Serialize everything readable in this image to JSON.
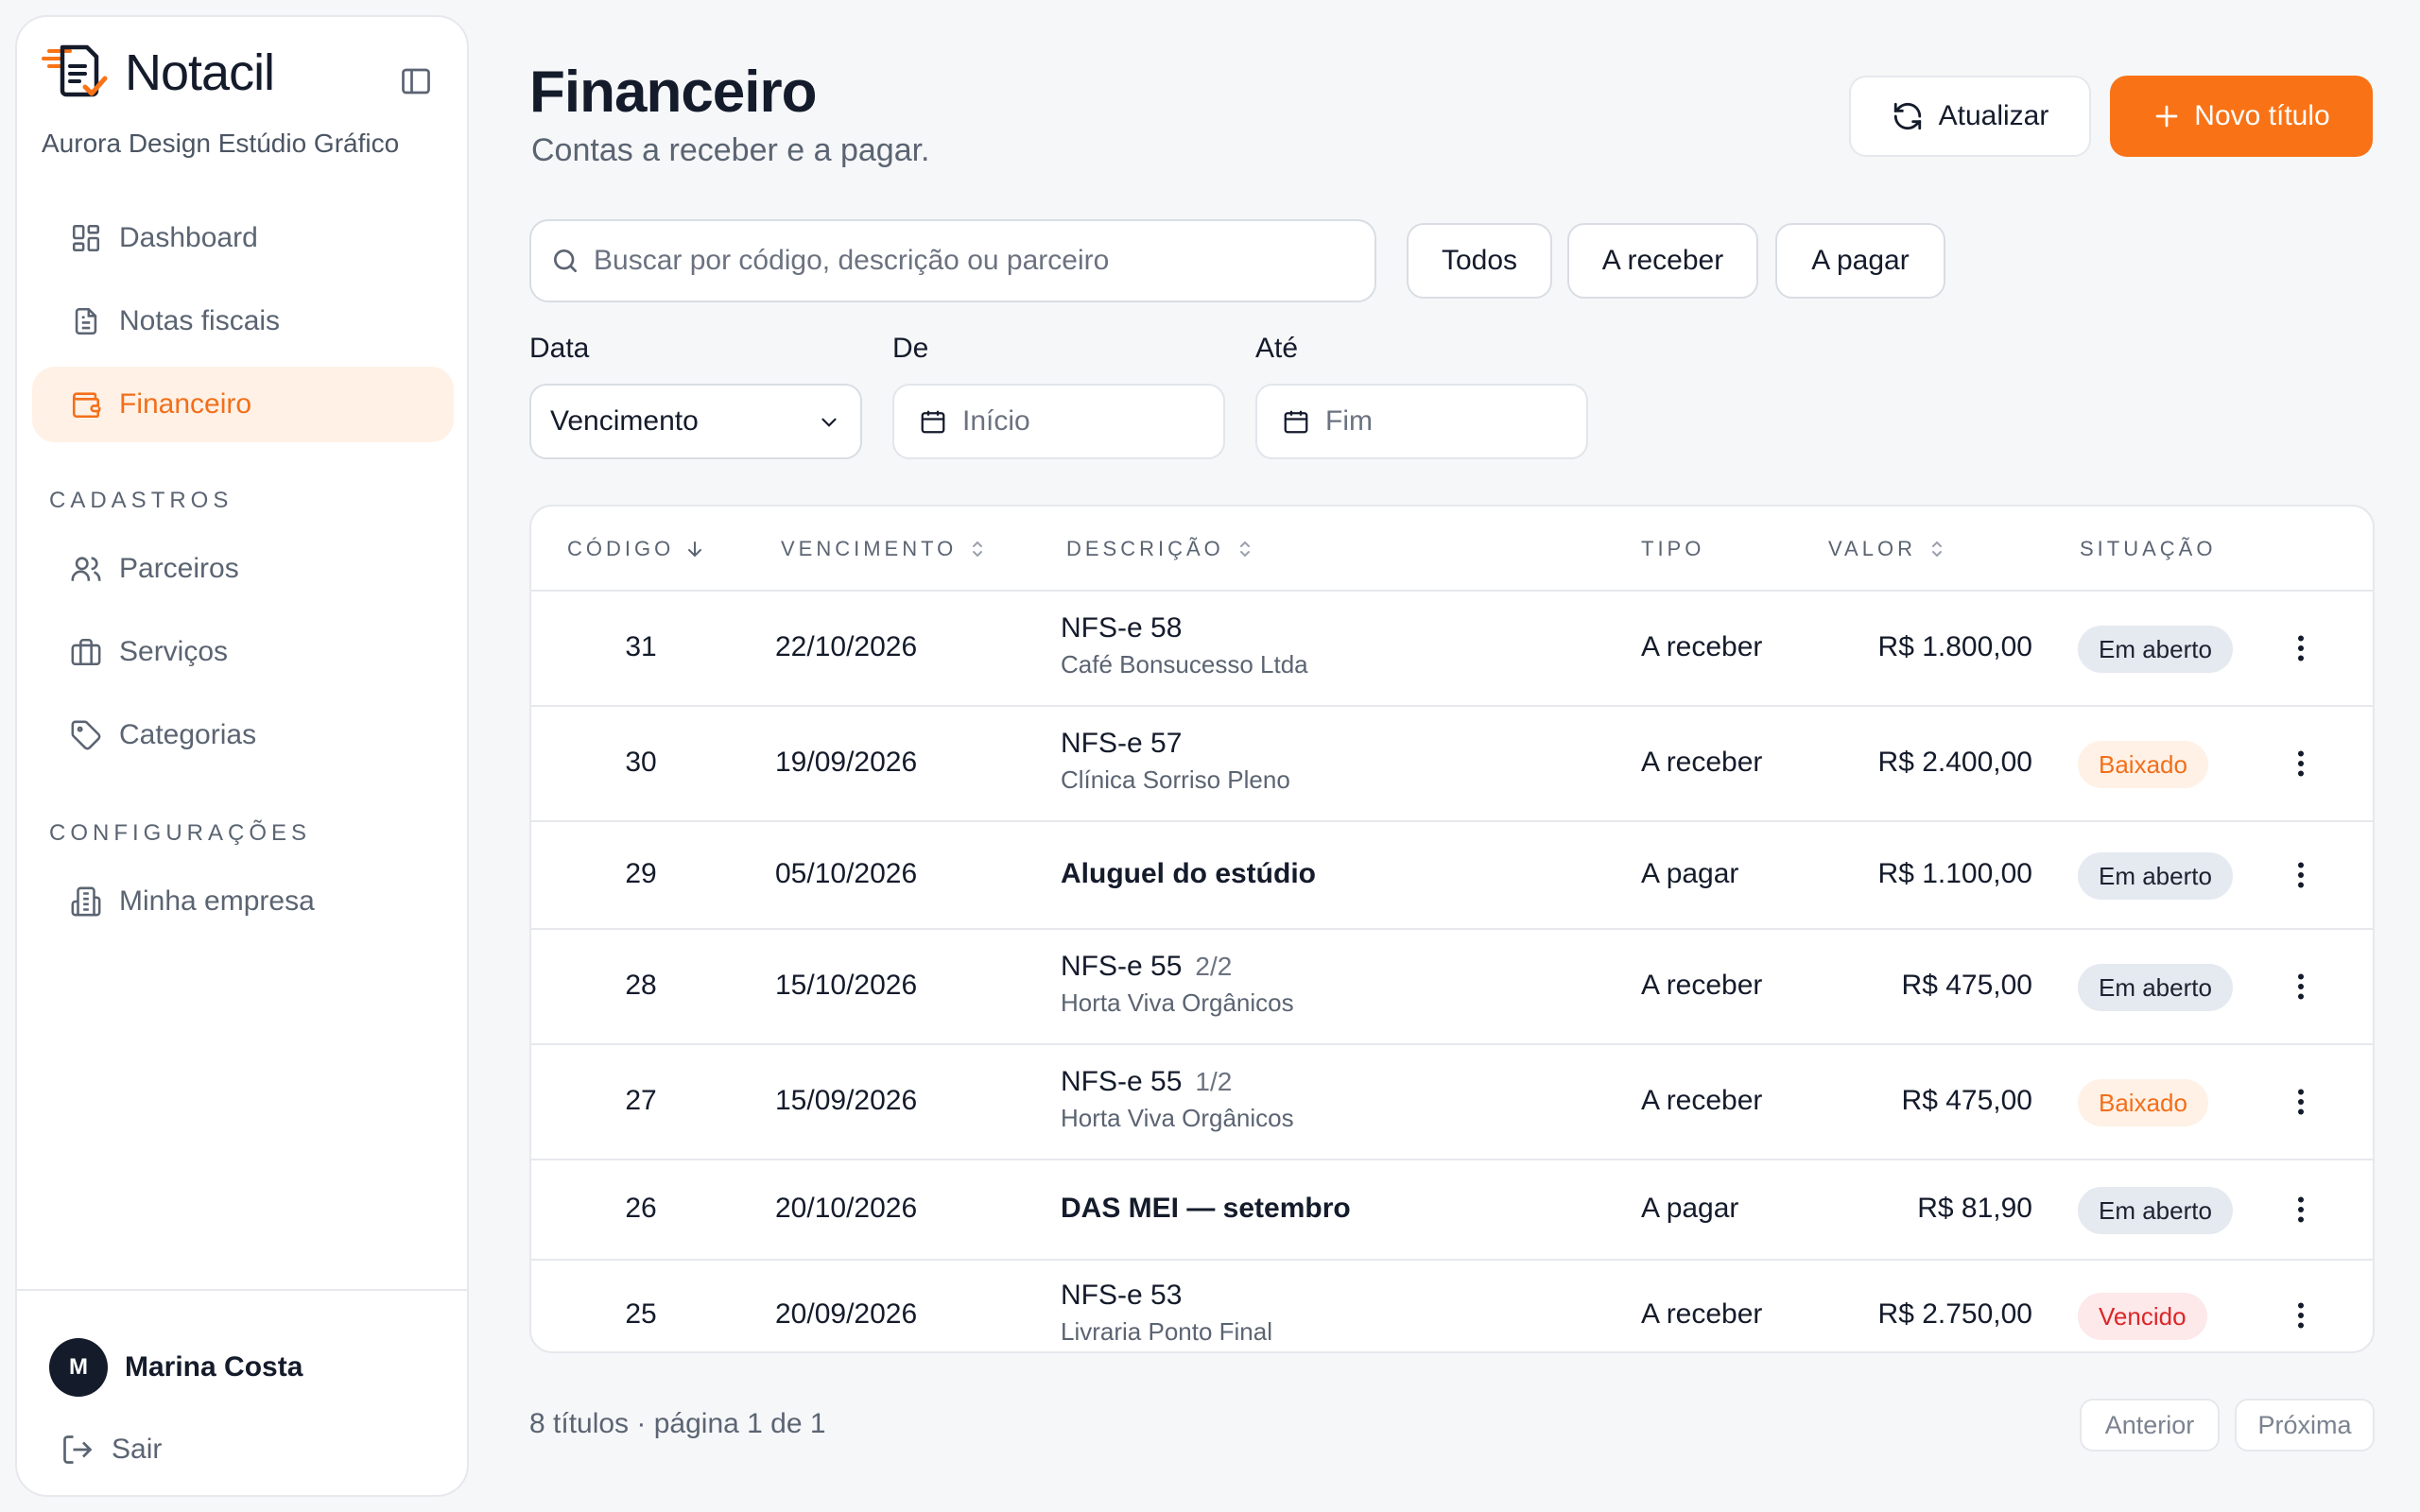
{
  "brand": {
    "name": "Notacil",
    "company": "Aurora Design Estúdio Gráfico"
  },
  "sidebar": {
    "main_items": [
      {
        "label": "Dashboard",
        "icon": "dashboard-icon",
        "active": false
      },
      {
        "label": "Notas fiscais",
        "icon": "document-icon",
        "active": false
      },
      {
        "label": "Financeiro",
        "icon": "wallet-icon",
        "active": true
      }
    ],
    "cadastros_label": "CADASTROS",
    "cadastros_items": [
      {
        "label": "Parceiros",
        "icon": "users-icon"
      },
      {
        "label": "Serviços",
        "icon": "briefcase-icon"
      },
      {
        "label": "Categorias",
        "icon": "tag-icon"
      }
    ],
    "config_label": "CONFIGURAÇÕES",
    "config_items": [
      {
        "label": "Minha empresa",
        "icon": "building-icon"
      }
    ],
    "user": {
      "initial": "M",
      "name": "Marina Costa"
    },
    "logout_label": "Sair"
  },
  "header": {
    "title": "Financeiro",
    "subtitle": "Contas a receber e a pagar.",
    "refresh_label": "Atualizar",
    "new_label": "Novo título"
  },
  "filters": {
    "search_placeholder": "Buscar por código, descrição ou parceiro",
    "tabs": [
      "Todos",
      "A receber",
      "A pagar"
    ],
    "date_label": "Data",
    "date_value": "Vencimento",
    "from_label": "De",
    "from_placeholder": "Início",
    "to_label": "Até",
    "to_placeholder": "Fim"
  },
  "table": {
    "columns": {
      "code": "CÓDIGO",
      "due": "VENCIMENTO",
      "description": "DESCRIÇÃO",
      "type": "TIPO",
      "value": "VALOR",
      "status": "SITUAÇÃO"
    },
    "rows": [
      {
        "code": "31",
        "due": "22/10/2026",
        "desc": "NFS-e 58",
        "installment": "",
        "partner": "Café Bonsucesso Ltda",
        "type": "A receber",
        "value": "R$ 1.800,00",
        "status": "Em aberto",
        "status_kind": "open"
      },
      {
        "code": "30",
        "due": "19/09/2026",
        "desc": "NFS-e 57",
        "installment": "",
        "partner": "Clínica Sorriso Pleno",
        "type": "A receber",
        "value": "R$ 2.400,00",
        "status": "Baixado",
        "status_kind": "paid"
      },
      {
        "code": "29",
        "due": "05/10/2026",
        "desc": "Aluguel do estúdio",
        "installment": "",
        "partner": "",
        "type": "A pagar",
        "value": "R$ 1.100,00",
        "status": "Em aberto",
        "status_kind": "open"
      },
      {
        "code": "28",
        "due": "15/10/2026",
        "desc": "NFS-e 55",
        "installment": "2/2",
        "partner": "Horta Viva Orgânicos",
        "type": "A receber",
        "value": "R$ 475,00",
        "status": "Em aberto",
        "status_kind": "open"
      },
      {
        "code": "27",
        "due": "15/09/2026",
        "desc": "NFS-e 55",
        "installment": "1/2",
        "partner": "Horta Viva Orgânicos",
        "type": "A receber",
        "value": "R$ 475,00",
        "status": "Baixado",
        "status_kind": "paid"
      },
      {
        "code": "26",
        "due": "20/10/2026",
        "desc": "DAS MEI — setembro",
        "installment": "",
        "partner": "",
        "type": "A pagar",
        "value": "R$ 81,90",
        "status": "Em aberto",
        "status_kind": "open"
      },
      {
        "code": "25",
        "due": "20/09/2026",
        "desc": "NFS-e 53",
        "installment": "",
        "partner": "Livraria Ponto Final",
        "type": "A receber",
        "value": "R$ 2.750,00",
        "status": "Vencido",
        "status_kind": "late"
      }
    ]
  },
  "pagination": {
    "info": "8 títulos · página 1 de 1",
    "prev": "Anterior",
    "next": "Próxima"
  },
  "colors": {
    "accent": "#f97316",
    "accent_soft": "#fff1e6",
    "danger": "#dc2626",
    "text": "#141b2b"
  }
}
